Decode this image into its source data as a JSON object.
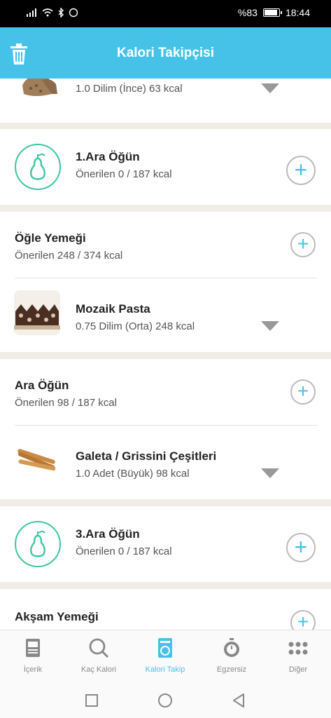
{
  "status": {
    "battery": "%83",
    "time": "18:44"
  },
  "app": {
    "title": "Kalori Takipçisi"
  },
  "top_partial_food": {
    "detail": "1.0 Dilim (İnce) 63 kcal"
  },
  "snack1": {
    "title": "1.Ara Öğün",
    "sub": "Önerilen 0 / 187 kcal"
  },
  "lunch": {
    "title": "Öğle Yemeği",
    "sub": "Önerilen 248 / 374 kcal",
    "food": {
      "name": "Mozaik Pasta",
      "detail": "0.75 Dilim (Orta) 248 kcal"
    }
  },
  "snack2": {
    "title": "Ara Öğün",
    "sub": "Önerilen 98 / 187 kcal",
    "food": {
      "name": "Galeta / Grissini Çeşitleri",
      "detail": "1.0 Adet (Büyük) 98 kcal"
    }
  },
  "snack3": {
    "title": "3.Ara Öğün",
    "sub": "Önerilen 0 / 187 kcal"
  },
  "dinner": {
    "title": "Akşam Yemeği"
  },
  "tabs": [
    {
      "label": "İçerik",
      "icon": "document-icon"
    },
    {
      "label": "Kaç Kalori",
      "icon": "search-icon"
    },
    {
      "label": "Kalori Takip",
      "icon": "scale-icon"
    },
    {
      "label": "Egzersiz",
      "icon": "stopwatch-icon"
    },
    {
      "label": "Diğer",
      "icon": "grid-dots-icon"
    }
  ],
  "colors": {
    "accent": "#46c2e8",
    "pear": "#3ec6a2"
  }
}
